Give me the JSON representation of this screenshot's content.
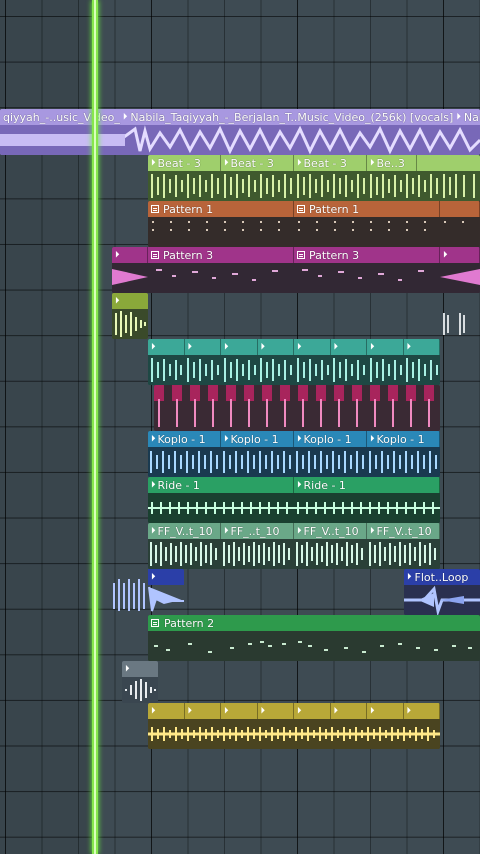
{
  "colors": {
    "background": "#3e4b53",
    "playhead": "#86e64d",
    "vocals": "#a898e0",
    "beat": "#9fcf6c",
    "pattern1": "#b8643a",
    "pattern3": "#a0348a",
    "teal": "#3ca898",
    "crimson": "#a8245c",
    "koplo": "#2a88b8",
    "ride": "#2aa064",
    "ff": "#6aa888",
    "flot": "#2b3fa8",
    "pattern2": "#2e9a4c",
    "grey": "#6a7882",
    "yellow": "#b8a838"
  },
  "tracks": {
    "vocals": {
      "label_a": "qiyyah_-..usic_Video_",
      "label_b": "Nabila_Taqiyyah_-_Berjalan_T..Music_Video_(256k) [vocals]",
      "label_c": "Nabi"
    },
    "beat": {
      "labels": [
        "Beat - 3",
        "Beat - 3",
        "Beat - 3",
        "Be..3"
      ]
    },
    "pattern1": {
      "labels": [
        "Pattern 1",
        "Pattern 1"
      ]
    },
    "pattern3": {
      "labels": [
        "Pattern 3",
        "Pattern 3"
      ]
    },
    "koplo": {
      "labels": [
        "Koplo - 1",
        "Koplo - 1",
        "Koplo - 1",
        "Koplo - 1"
      ]
    },
    "ride": {
      "labels": [
        "Ride - 1",
        "Ride - 1"
      ]
    },
    "ff": {
      "labels": [
        "FF_V..t_10",
        "FF_..t_10",
        "FF_V..t_10",
        "FF_V..t_10"
      ]
    },
    "flot": {
      "label": "Flot..Loop"
    },
    "pattern2": {
      "label": "Pattern 2"
    }
  }
}
